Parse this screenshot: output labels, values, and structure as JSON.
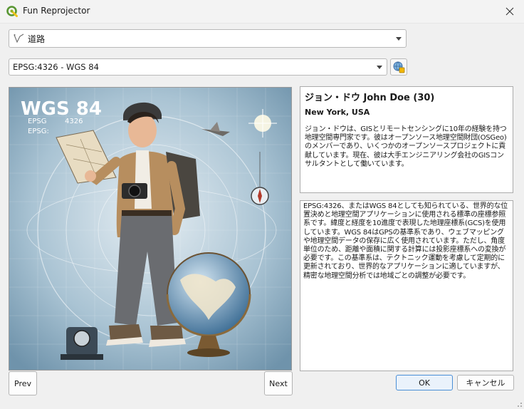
{
  "window": {
    "title": "Fun Reprojector"
  },
  "layer_select": {
    "icon": "line-layer-icon",
    "value": "道路"
  },
  "crs_select": {
    "value": "EPSG:4326 - WGS 84"
  },
  "image": {
    "heading": "WGS 84",
    "caption_1": "EPSG",
    "caption_code": "4326",
    "caption_2": "EPSG:"
  },
  "person": {
    "name": "ジョン・ドウ John Doe (30)",
    "location": "New York, USA",
    "bio": "ジョン・ドウは、GISとリモートセンシングに10年の経験を持つ地理空間専門家です。彼はオープンソース地理空間財団(OSGeo)のメンバーであり、いくつかのオープンソースプロジェクトに貢献しています。現在、彼は大手エンジニアリング会社のGISコンサルタントとして働いています。"
  },
  "crs_description": "EPSG:4326、またはWGS 84としても知られている、世界的な位置決めと地理空間アプリケーションに使用される標準の座標参照系です。緯度と経度を10進度で表現した地理座標系(GCS)を使用しています。WGS 84はGPSの基準系であり、ウェブマッピングや地理空間データの保存に広く使用されています。ただし、角度単位のため、距離や面積に関する計算には投影座標系への変換が必要です。この基準系は、テクトニック運動を考慮して定期的に更新されており、世界的なアプリケーションに適していますが、精密な地理空間分析では地域ごとの調整が必要です。",
  "buttons": {
    "prev": "Prev",
    "next": "Next",
    "ok": "OK",
    "cancel": "キャンセル"
  }
}
